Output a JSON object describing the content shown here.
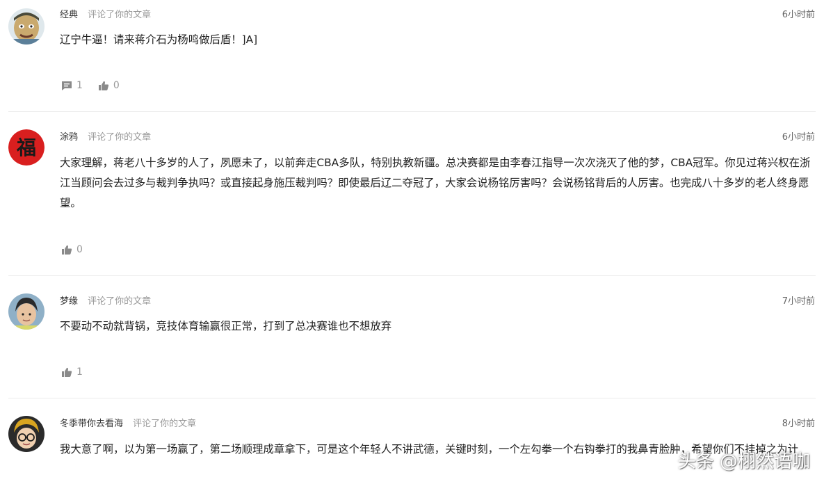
{
  "comments": [
    {
      "username": "经典",
      "action": "评论了你的文章",
      "time": "6小时前",
      "text": "辽宁牛逼！请来蒋介石为杨鸣做后盾！]A]",
      "reply_count": "1",
      "like_count": "0"
    },
    {
      "username": "涂鸦",
      "action": "评论了你的文章",
      "time": "6小时前",
      "text": "大家理解，蒋老八十多岁的人了，夙愿未了，以前奔走CBA多队，特别执教新疆。总决赛都是由李春江指导一次次浇灭了他的梦，CBA冠军。你见过蒋兴权在浙江当顾问会去过多与裁判争执吗？或直接起身施压裁判吗？即使最后辽二夺冠了，大家会说杨铭厉害吗？会说杨铭背后的人厉害。也完成八十多岁的老人终身愿望。",
      "like_count": "0"
    },
    {
      "username": "梦缘",
      "action": "评论了你的文章",
      "time": "7小时前",
      "text": "不要动不动就背锅，竞技体育输赢很正常，打到了总决赛谁也不想放弃",
      "like_count": "1"
    },
    {
      "username": "冬季带你去看海",
      "action": "评论了你的文章",
      "time": "8小时前",
      "text": "我大意了啊，以为第一场赢了，第二场顺理成章拿下，可是这个年轻人不讲武德，关键时刻，一个左勾拳一个右钩拳打的我鼻青脸肿，希望你们不挂掉之为计"
    }
  ],
  "watermark": "头条 @栩然语咖",
  "icons": {
    "comment": "comment-bubble-icon",
    "like": "thumbs-up-icon"
  },
  "colors": {
    "text": "#222222",
    "muted": "#999999",
    "divider": "#ececec",
    "icon": "#8a8a8a"
  }
}
